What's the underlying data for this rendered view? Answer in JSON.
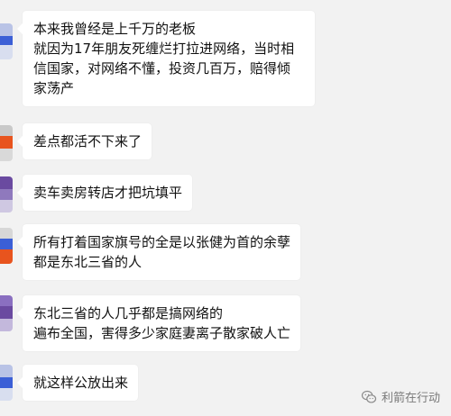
{
  "messages": [
    {
      "text": "本来我曾经是上千万的老板\n就因为17年朋友死缠烂打拉进网络，当时相\n信国家，对网络不懂，投资几百万，赔得倾\n家荡产"
    },
    {
      "text": "差点都活不下来了"
    },
    {
      "text": "卖车卖房转店才把坑填平"
    },
    {
      "text": "所有打着国家旗号的全是以张健为首的余孽\n都是东北三省的人"
    },
    {
      "text": "东北三省的人几乎都是搞网络的\n遍布全国，害得多少家庭妻离子散家破人亡"
    },
    {
      "text": "就这样公放出来"
    }
  ],
  "watermark": {
    "label": "利箭在行动",
    "icon": "wechat-icon"
  },
  "colors": {
    "background": "#f2f2f2",
    "bubble": "#ffffff",
    "avatar_accent_blue": "#3b5fd6",
    "avatar_accent_orange": "#e8541e",
    "avatar_accent_purple": "#6a4aa0"
  }
}
